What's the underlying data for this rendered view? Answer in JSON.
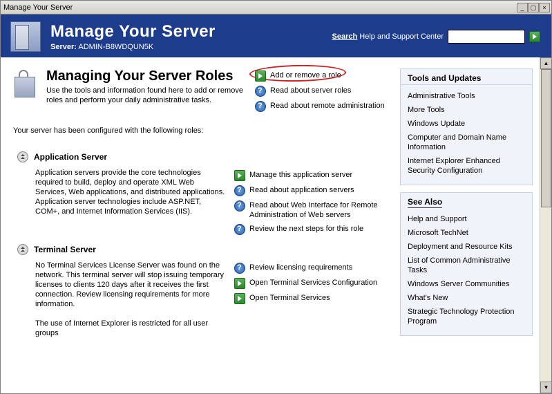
{
  "titlebar": {
    "text": "Manage Your Server"
  },
  "header": {
    "title": "Manage Your Server",
    "server_label": "Server:",
    "server_name": "ADMIN-B8WDQUN5K",
    "search_label_accel": "S",
    "search_label_rest": "earch",
    "search_suffix": " Help and Support Center",
    "search_placeholder": ""
  },
  "roles": {
    "heading": "Managing Your Server Roles",
    "description": "Use the tools and information found here to add or remove roles and perform your daily administrative tasks.",
    "top_actions": [
      {
        "icon": "arrow",
        "label": "Add or remove a role",
        "circled": true
      },
      {
        "icon": "help",
        "label": "Read about server roles"
      },
      {
        "icon": "help",
        "label": "Read about remote administration"
      }
    ],
    "configured_line": "Your server has been configured with the following roles:",
    "blocks": [
      {
        "name": "Application Server",
        "desc": "Application servers provide the core technologies required to build, deploy and operate XML Web Services, Web applications, and distributed applications. Application server technologies include ASP.NET, COM+, and Internet Information Services (IIS).",
        "actions": [
          {
            "icon": "arrow",
            "label": "Manage this application server"
          },
          {
            "icon": "help",
            "label": "Read about application servers"
          },
          {
            "icon": "help",
            "label": "Read about Web Interface for Remote Administration of Web servers"
          },
          {
            "icon": "help",
            "label": "Review the next steps for this role"
          }
        ]
      },
      {
        "name": "Terminal Server",
        "desc": "No Terminal Services License Server was found on the network. This terminal server will stop issuing temporary licenses to clients 120 days after it receives the first connection. Review licensing requirements for more information.",
        "desc2": "The use of Internet Explorer is restricted for all user groups",
        "actions": [
          {
            "icon": "help",
            "label": "Review licensing requirements"
          },
          {
            "icon": "arrow",
            "label": "Open Terminal Services Configuration"
          },
          {
            "icon": "arrow",
            "label": "Open Terminal Services"
          }
        ]
      }
    ]
  },
  "panels": {
    "tools": {
      "title": "Tools and Updates",
      "items": [
        "Administrative Tools",
        "More Tools",
        "Windows Update",
        "Computer and Domain Name Information",
        "Internet Explorer Enhanced Security Configuration"
      ]
    },
    "see_also": {
      "title": "See Also",
      "items": [
        "Help and Support",
        "Microsoft TechNet",
        "Deployment and Resource Kits",
        "List of Common Administrative Tasks",
        "Windows Server Communities",
        "What's New",
        "Strategic Technology Protection Program"
      ]
    }
  }
}
